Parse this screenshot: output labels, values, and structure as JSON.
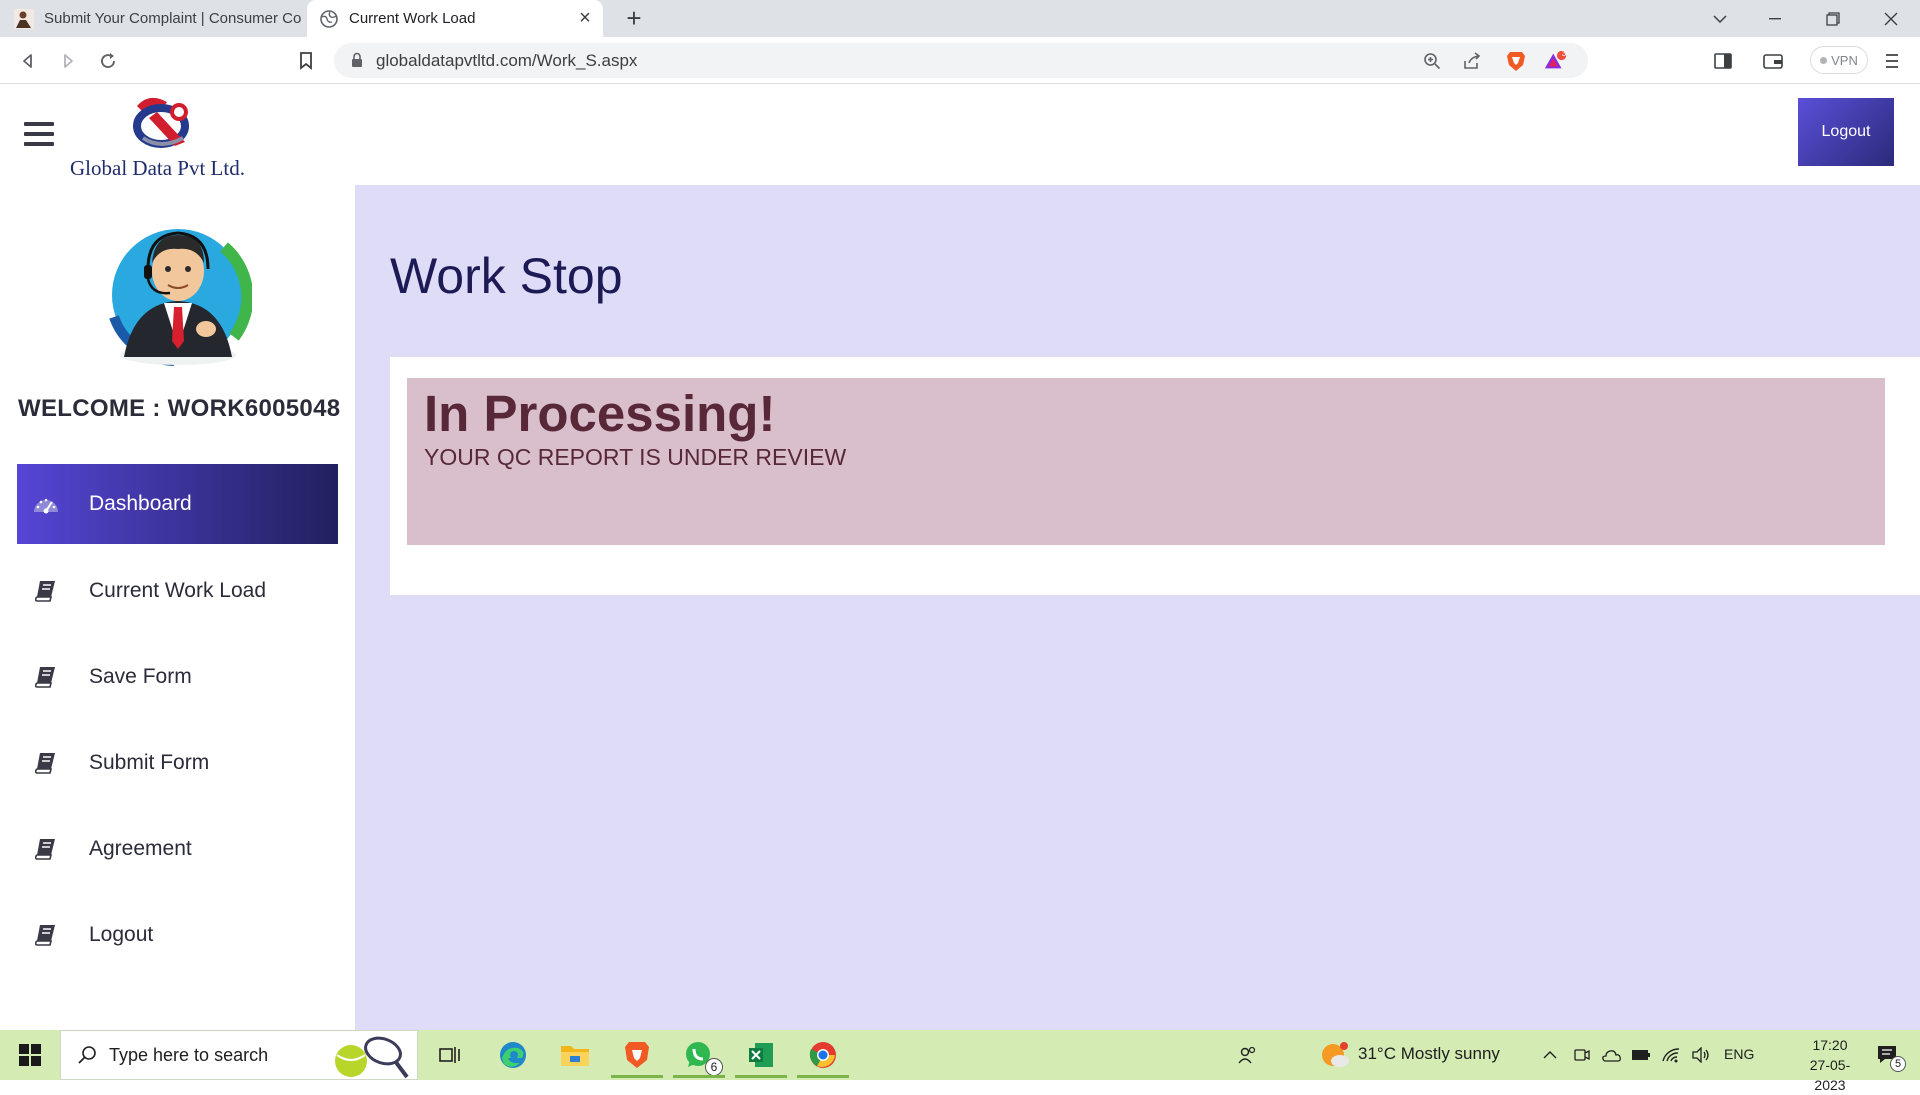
{
  "browser": {
    "tabs": [
      {
        "title": "Submit Your Complaint | Consumer Co",
        "active": false
      },
      {
        "title": "Current Work Load",
        "active": true
      }
    ],
    "url": "globaldatapvtltd.com/Work_S.aspx",
    "vpn_label": "VPN",
    "brave_alert_count": "3"
  },
  "header": {
    "logo_text": "Global Data Pvt Ltd.",
    "logout_label": "Logout"
  },
  "sidebar": {
    "welcome": "WELCOME : WORK6005048",
    "items": [
      {
        "label": "Dashboard",
        "icon": "tachometer-icon",
        "active": true
      },
      {
        "label": "Current Work Load",
        "icon": "book-icon",
        "active": false
      },
      {
        "label": "Save Form",
        "icon": "book-icon",
        "active": false
      },
      {
        "label": "Submit Form",
        "icon": "book-icon",
        "active": false
      },
      {
        "label": "Agreement",
        "icon": "book-icon",
        "active": false
      },
      {
        "label": "Logout",
        "icon": "book-icon",
        "active": false
      }
    ]
  },
  "main": {
    "title": "Work Stop",
    "alert_heading": "In Processing!",
    "alert_message": "YOUR QC REPORT IS UNDER REVIEW"
  },
  "taskbar": {
    "search_placeholder": "Type here to search",
    "whatsapp_badge": "6",
    "weather": "31°C  Mostly sunny",
    "language": "ENG",
    "time": "17:20",
    "date": "27-05-2023",
    "notification_count": "5"
  },
  "colors": {
    "main_bg": "#dfdcf8",
    "accent_gradient_start": "#5546d6",
    "accent_gradient_end": "#23205e",
    "alert_bg": "#d9bfcc",
    "alert_text": "#582838",
    "title_text": "#1d1b55",
    "taskbar_bg": "#d4ecb4"
  }
}
